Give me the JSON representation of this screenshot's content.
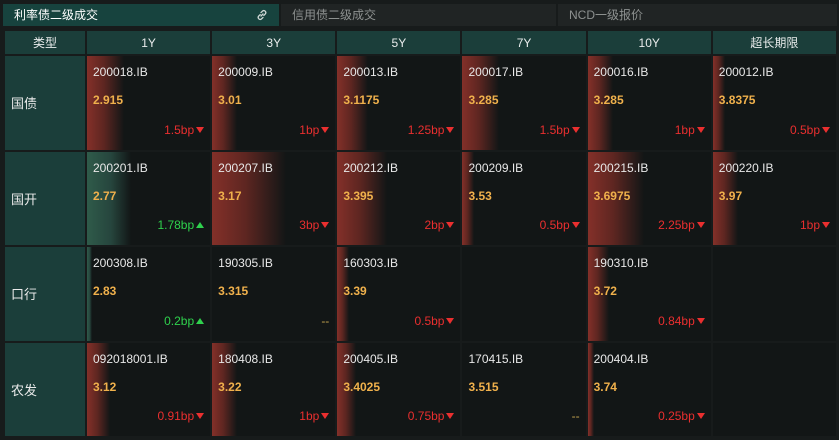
{
  "tabs": [
    {
      "label": "利率债二级成交",
      "active": true
    },
    {
      "label": "信用债二级成交",
      "active": false
    },
    {
      "label": "NCD一级报价",
      "active": false
    }
  ],
  "header": [
    "类型",
    "1Y",
    "3Y",
    "5Y",
    "7Y",
    "10Y",
    "超长期限"
  ],
  "colors": {
    "up": "#2fd14d",
    "down": "#ea2f2f",
    "yield": "#f0b14c",
    "flat": "#c2a24e",
    "header_bg": "#1b3e3a"
  },
  "rows": [
    {
      "type": "国债",
      "cells": [
        {
          "code": "200018.IB",
          "yield": "2.915",
          "change": "1.5bp",
          "dir": "down",
          "level": 0.3
        },
        {
          "code": "200009.IB",
          "yield": "3.01",
          "change": "1bp",
          "dir": "down",
          "level": 0.2
        },
        {
          "code": "200013.IB",
          "yield": "3.1175",
          "change": "1.25bp",
          "dir": "down",
          "level": 0.25
        },
        {
          "code": "200017.IB",
          "yield": "3.285",
          "change": "1.5bp",
          "dir": "down",
          "level": 0.3
        },
        {
          "code": "200016.IB",
          "yield": "3.285",
          "change": "1bp",
          "dir": "down",
          "level": 0.2
        },
        {
          "code": "200012.IB",
          "yield": "3.8375",
          "change": "0.5bp",
          "dir": "down",
          "level": 0.1
        }
      ]
    },
    {
      "type": "国开",
      "cells": [
        {
          "code": "200201.IB",
          "yield": "2.77",
          "change": "1.78bp",
          "dir": "up",
          "level": 0.356
        },
        {
          "code": "200207.IB",
          "yield": "3.17",
          "change": "3bp",
          "dir": "down",
          "level": 0.6
        },
        {
          "code": "200212.IB",
          "yield": "3.395",
          "change": "2bp",
          "dir": "down",
          "level": 0.4
        },
        {
          "code": "200209.IB",
          "yield": "3.53",
          "change": "0.5bp",
          "dir": "down",
          "level": 0.1
        },
        {
          "code": "200215.IB",
          "yield": "3.6975",
          "change": "2.25bp",
          "dir": "down",
          "level": 0.45
        },
        {
          "code": "200220.IB",
          "yield": "3.97",
          "change": "1bp",
          "dir": "down",
          "level": 0.2
        }
      ]
    },
    {
      "type": "口行",
      "cells": [
        {
          "code": "200308.IB",
          "yield": "2.83",
          "change": "0.2bp",
          "dir": "up",
          "level": 0.04
        },
        {
          "code": "190305.IB",
          "yield": "3.315",
          "change": "--",
          "dir": "flat",
          "level": 0
        },
        {
          "code": "160303.IB",
          "yield": "3.39",
          "change": "0.5bp",
          "dir": "down",
          "level": 0.1
        },
        null,
        {
          "code": "190310.IB",
          "yield": "3.72",
          "change": "0.84bp",
          "dir": "down",
          "level": 0.168
        },
        null
      ]
    },
    {
      "type": "农发",
      "cells": [
        {
          "code": "092018001.IB",
          "yield": "3.12",
          "change": "0.91bp",
          "dir": "down",
          "level": 0.182
        },
        {
          "code": "180408.IB",
          "yield": "3.22",
          "change": "1bp",
          "dir": "down",
          "level": 0.2
        },
        {
          "code": "200405.IB",
          "yield": "3.4025",
          "change": "0.75bp",
          "dir": "down",
          "level": 0.15
        },
        {
          "code": "170415.IB",
          "yield": "3.515",
          "change": "--",
          "dir": "flat",
          "level": 0
        },
        {
          "code": "200404.IB",
          "yield": "3.74",
          "change": "0.25bp",
          "dir": "down",
          "level": 0.05
        },
        null
      ]
    }
  ]
}
